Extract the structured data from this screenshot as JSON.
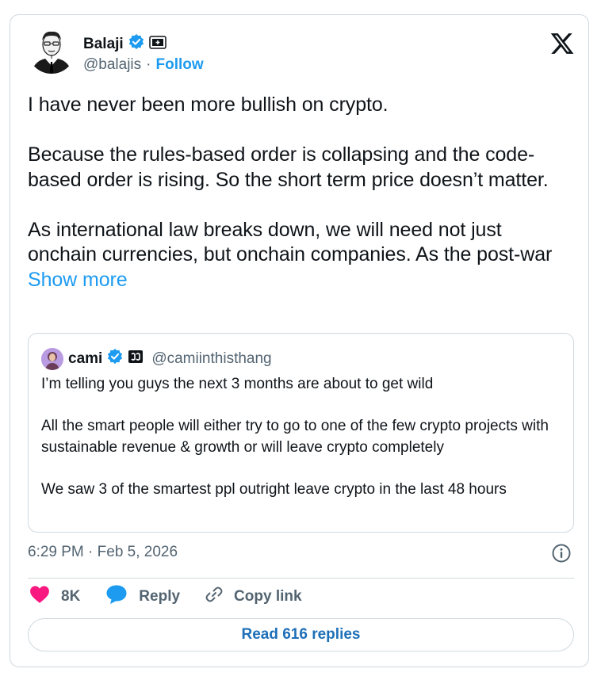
{
  "author": {
    "name": "Balaji",
    "handle": "@balajis",
    "separator": "·",
    "follow_label": "Follow"
  },
  "tweet": {
    "paragraphs": [
      "I have never been more bullish on crypto.",
      "Because the rules-based order is collapsing and the code-based order is rising. So the short term price doesn’t matter.",
      "As international law breaks down, we will need not just onchain currencies, but onchain companies. As the post-war"
    ],
    "show_more": "Show more"
  },
  "quote": {
    "name": "cami",
    "handle": "@camiinthisthang",
    "paragraphs": [
      "I’m telling you guys the next 3 months are about to get wild",
      "All the smart people will either try to go to one of the few crypto projects with sustainable revenue & growth or will leave crypto completely",
      "We saw 3 of the smartest ppl outright leave crypto in the last 48 hours"
    ]
  },
  "timestamp": "6:29 PM · Feb 5, 2026",
  "actions": {
    "like_count": "8K",
    "reply_label": "Reply",
    "copy_link_label": "Copy link"
  },
  "read_replies_label": "Read 616 replies",
  "icons": {
    "verified": "verified-badge-icon",
    "affiliate": "affiliate-badge-icon",
    "x_logo": "x-logo-icon",
    "info": "info-icon",
    "like": "heart-icon",
    "reply": "speech-bubble-icon",
    "copy": "link-icon"
  },
  "colors": {
    "accent": "#1d9bf0",
    "like": "#f91880",
    "secondary_text": "#536471",
    "border": "#cfd9de"
  }
}
